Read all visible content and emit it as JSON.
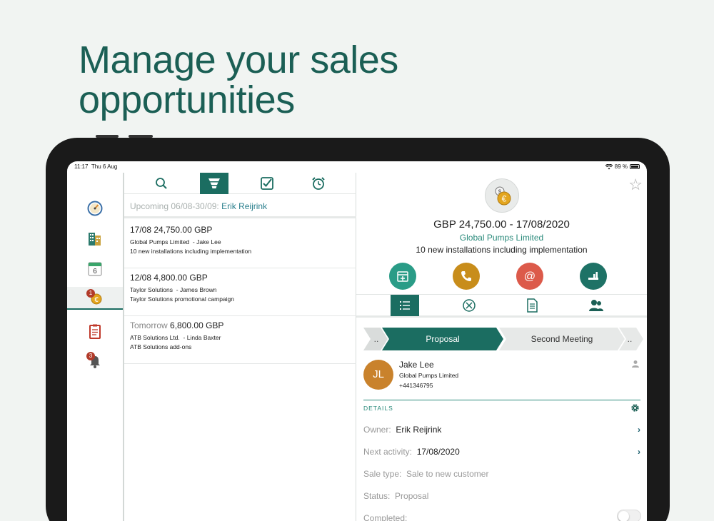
{
  "headline": {
    "line1": "Manage your sales",
    "line2": "opportunities"
  },
  "status": {
    "time": "11:17",
    "date": "Thu 6 Aug",
    "battery": "89 %"
  },
  "sidebar": {
    "items": [
      {
        "name": "dashboard",
        "badge": ""
      },
      {
        "name": "companies",
        "badge": ""
      },
      {
        "name": "calendar",
        "badge": "",
        "day": "6"
      },
      {
        "name": "sales",
        "badge": "1"
      },
      {
        "name": "tasks",
        "badge": ""
      },
      {
        "name": "notifications",
        "badge": "3"
      }
    ]
  },
  "list": {
    "filter_label": "Upcoming 06/08-30/09:",
    "filter_person": "Erik Reijrink",
    "items": [
      {
        "date": "17/08",
        "amount": "24,750.00 GBP",
        "company": "Global Pumps Limited",
        "contact": "- Jake Lee",
        "description": "10 new installations including implementation"
      },
      {
        "date": "12/08",
        "amount": "4,800.00 GBP",
        "company": "Taylor Solutions",
        "contact": "- James Brown",
        "description": "Taylor Solutions promotional campaign"
      },
      {
        "date": "Tomorrow",
        "amount": "6,800.00 GBP",
        "company": "ATB Solutions Ltd.",
        "contact": "- Linda Baxter",
        "description": "ATB Solutions add-ons"
      }
    ]
  },
  "detail": {
    "amount_line": "GBP 24,750.00 - 17/08/2020",
    "company": "Global Pumps Limited",
    "description": "10 new installations including implementation",
    "colors": {
      "calendar": "#2a9c87",
      "phone": "#c88d1b",
      "email": "#dc5a4a",
      "stage": "#1e7266"
    },
    "pipeline": {
      "prev": "..",
      "current": "Proposal",
      "next": "Second Meeting",
      "more": ".."
    },
    "contact": {
      "initials": "JL",
      "name": "Jake Lee",
      "company": "Global Pumps Limited",
      "phone": "+441346795"
    },
    "details_header": "DETAILS",
    "fields": {
      "owner_label": "Owner:",
      "owner_value": "Erik Reijrink",
      "next_label": "Next activity:",
      "next_value": "17/08/2020",
      "saletype_label": "Sale type:",
      "saletype_value": "Sale to new customer",
      "status_label": "Status:",
      "status_value": "Proposal",
      "completed_label": "Completed:"
    }
  }
}
